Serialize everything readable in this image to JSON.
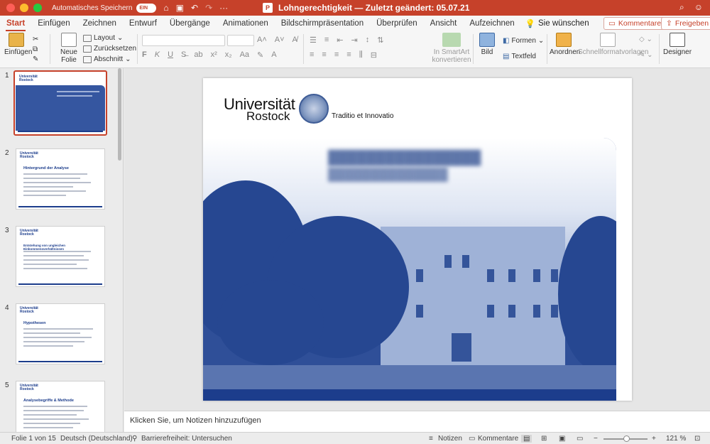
{
  "window": {
    "autosave_label": "Automatisches Speichern",
    "autosave_state": "EIN",
    "app_badge": "P",
    "title": "Lohngerechtigkeit — Zuletzt geändert: 05.07.21"
  },
  "tabs": [
    "Start",
    "Einfügen",
    "Zeichnen",
    "Entwurf",
    "Übergänge",
    "Animationen",
    "Bildschirmpräsentation",
    "Überprüfen",
    "Ansicht",
    "Aufzeichnen"
  ],
  "tell_me": "Sie wünschen",
  "buttons": {
    "comments": "Kommentare",
    "share": "Freigeben"
  },
  "ribbon": {
    "paste": "Einfügen",
    "new_slide_1": "Neue",
    "new_slide_2": "Folie",
    "layout": "Layout",
    "reset": "Zurücksetzen",
    "section": "Abschnitt",
    "smartart_1": "In SmartArt",
    "smartart_2": "konvertieren",
    "picture": "Bild",
    "shapes": "Formen",
    "textbox": "Textfeld",
    "arrange": "Anordnen",
    "quick_styles": "Schnellformatvorlagen",
    "designer": "Designer"
  },
  "slides": [
    {
      "num": "1",
      "title": ""
    },
    {
      "num": "2",
      "title": "Hintergrund der Analyse"
    },
    {
      "num": "3",
      "title": "Entstehung von ungleichen Einkommensverhältnissen"
    },
    {
      "num": "4",
      "title": "Hypothesen"
    },
    {
      "num": "5",
      "title": "Analysebegriffe & Methode"
    }
  ],
  "slide": {
    "university_line1": "Universität",
    "university_line2": "Rostock",
    "motto": "Traditio et Innovatio"
  },
  "notes_placeholder": "Klicken Sie, um Notizen hinzuzufügen",
  "status": {
    "slide_of": "Folie 1 von 15",
    "language": "Deutsch (Deutschland)",
    "accessibility": "Barrierefreiheit: Untersuchen",
    "notes": "Notizen",
    "comments": "Kommentare",
    "zoom": "121 %"
  },
  "colors": {
    "accent": "#c6412a",
    "brand_blue": "#1c3d8c"
  }
}
